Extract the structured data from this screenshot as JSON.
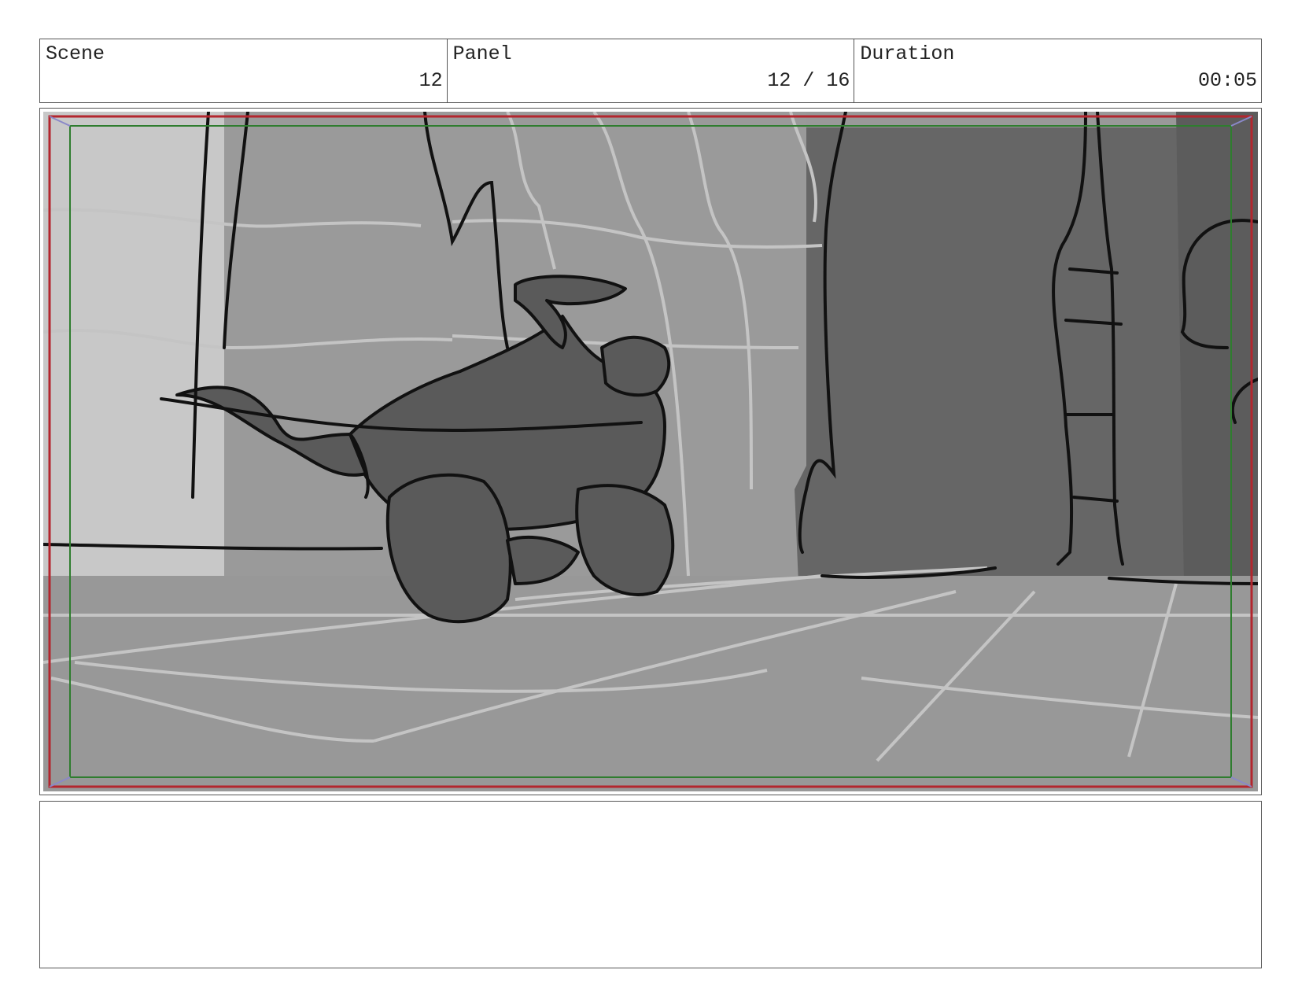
{
  "header": {
    "scene": {
      "label": "Scene",
      "value": "12"
    },
    "panel": {
      "label": "Panel",
      "value": "12 / 16"
    },
    "duration": {
      "label": "Duration",
      "value": "00:05"
    }
  },
  "colors": {
    "safe_outer": "#b3262e",
    "safe_inner": "#2f7d2f",
    "corner_marks": "#8a88c8",
    "sketch_ink": "#111111"
  },
  "notes": {
    "text": ""
  }
}
